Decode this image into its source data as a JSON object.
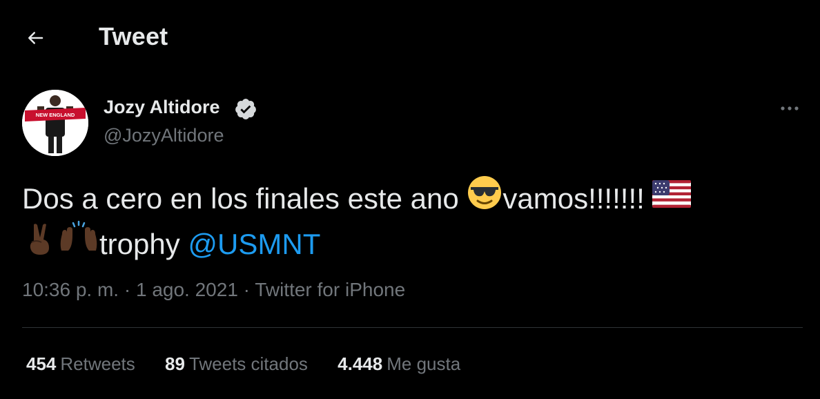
{
  "header": {
    "title": "Tweet",
    "back_icon": "arrow-left-icon"
  },
  "author": {
    "name": "Jozy Altidore",
    "handle": "@JozyAltidore",
    "verified_icon": "verified-badge-icon",
    "avatar_scarf_text": "NEW ENGLAND"
  },
  "more_icon": "more-dots-icon",
  "tweet": {
    "part1": "Dos a cero en los finales este ano ",
    "emoji1": "sunglasses-face",
    "part2": "vamos!!!!!!! ",
    "emoji2": "us-flag",
    "emoji3": "victory-hand-dark-skin",
    "emoji4": "raising-hands-dark-skin",
    "part3": "trophy ",
    "mention": "@USMNT"
  },
  "meta": {
    "time": "10:36 p. m.",
    "sep1": " · ",
    "date": "1 ago. 2021",
    "sep2": " · ",
    "source": "Twitter for iPhone"
  },
  "stats": [
    {
      "count": "454",
      "label": "Retweets"
    },
    {
      "count": "89",
      "label": "Tweets citados"
    },
    {
      "count": "4.448",
      "label": "Me gusta"
    }
  ],
  "colors": {
    "background": "#000000",
    "text": "#e7e9ea",
    "secondary": "#71767b",
    "link": "#1d9bf0",
    "divider": "#2f3336"
  }
}
